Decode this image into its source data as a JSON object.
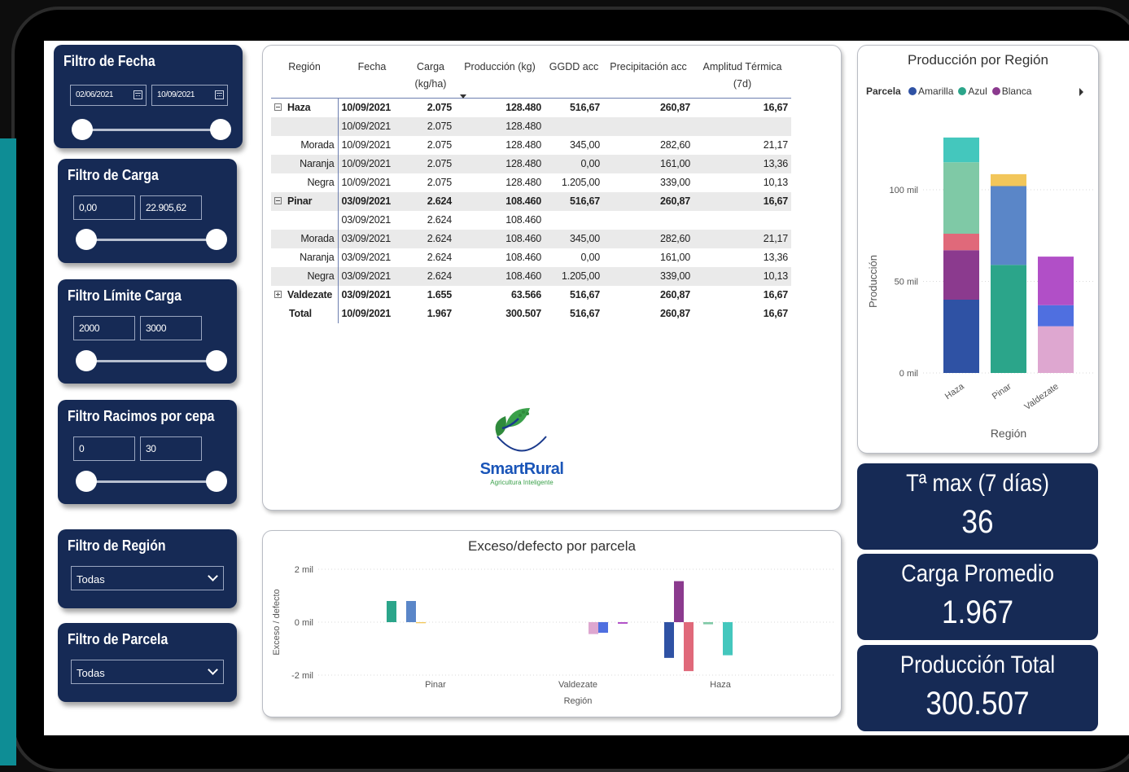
{
  "filters": {
    "fecha": {
      "title": "Filtro de Fecha",
      "start": "02/06/2021",
      "end": "10/09/2021"
    },
    "carga": {
      "title": "Filtro de Carga",
      "min": "0,00",
      "max": "22.905,62"
    },
    "limite": {
      "title": "Filtro Límite Carga",
      "min": "2000",
      "max": "3000"
    },
    "racimos": {
      "title": "Filtro Racimos por cepa",
      "min": "0",
      "max": "30"
    },
    "region": {
      "title": "Filtro de Región",
      "selected": "Todas"
    },
    "parcela": {
      "title": "Filtro de Parcela",
      "selected": "Todas"
    }
  },
  "matrix": {
    "headers": [
      "Región",
      "Fecha",
      "Carga (kg/ha)",
      "Producción (kg)",
      "GGDD acc",
      "Precipitación acc",
      "Amplitud Térmica (7d)"
    ],
    "rows": [
      {
        "type": "group",
        "expander": "minus",
        "region": "Haza",
        "fecha": "10/09/2021",
        "carga": "2.075",
        "prod": "128.480",
        "ggdd": "516,67",
        "precip": "260,87",
        "amp": "16,67"
      },
      {
        "type": "detail",
        "shade": true,
        "region": "",
        "fecha": "10/09/2021",
        "carga": "2.075",
        "prod": "128.480",
        "ggdd": "",
        "precip": "",
        "amp": ""
      },
      {
        "type": "detail",
        "shade": false,
        "region": "Morada",
        "fecha": "10/09/2021",
        "carga": "2.075",
        "prod": "128.480",
        "ggdd": "345,00",
        "precip": "282,60",
        "amp": "21,17"
      },
      {
        "type": "detail",
        "shade": true,
        "region": "Naranja",
        "fecha": "10/09/2021",
        "carga": "2.075",
        "prod": "128.480",
        "ggdd": "0,00",
        "precip": "161,00",
        "amp": "13,36"
      },
      {
        "type": "detail",
        "shade": false,
        "region": "Negra",
        "fecha": "10/09/2021",
        "carga": "2.075",
        "prod": "128.480",
        "ggdd": "1.205,00",
        "precip": "339,00",
        "amp": "10,13"
      },
      {
        "type": "group",
        "expander": "minus",
        "shade": true,
        "region": "Pinar",
        "fecha": "03/09/2021",
        "carga": "2.624",
        "prod": "108.460",
        "ggdd": "516,67",
        "precip": "260,87",
        "amp": "16,67"
      },
      {
        "type": "detail",
        "shade": false,
        "region": "",
        "fecha": "03/09/2021",
        "carga": "2.624",
        "prod": "108.460",
        "ggdd": "",
        "precip": "",
        "amp": ""
      },
      {
        "type": "detail",
        "shade": true,
        "region": "Morada",
        "fecha": "03/09/2021",
        "carga": "2.624",
        "prod": "108.460",
        "ggdd": "345,00",
        "precip": "282,60",
        "amp": "21,17"
      },
      {
        "type": "detail",
        "shade": false,
        "region": "Naranja",
        "fecha": "03/09/2021",
        "carga": "2.624",
        "prod": "108.460",
        "ggdd": "0,00",
        "precip": "161,00",
        "amp": "13,36"
      },
      {
        "type": "detail",
        "shade": true,
        "region": "Negra",
        "fecha": "03/09/2021",
        "carga": "2.624",
        "prod": "108.460",
        "ggdd": "1.205,00",
        "precip": "339,00",
        "amp": "10,13"
      },
      {
        "type": "group",
        "expander": "plus",
        "shade": false,
        "region": "Valdezate",
        "fecha": "03/09/2021",
        "carga": "1.655",
        "prod": "63.566",
        "ggdd": "516,67",
        "precip": "260,87",
        "amp": "16,67"
      },
      {
        "type": "total",
        "shade": false,
        "region": "Total",
        "fecha": "10/09/2021",
        "carga": "1.967",
        "prod": "300.507",
        "ggdd": "516,67",
        "precip": "260,87",
        "amp": "16,67"
      }
    ]
  },
  "logo": {
    "name": "SmartRural",
    "tagline": "Agricultura Inteligente"
  },
  "kpis": [
    {
      "label": "Tª max (7 días)",
      "value": "36"
    },
    {
      "label": "Carga Promedio",
      "value": "1.967"
    },
    {
      "label": "Producción Total",
      "value": "300.507"
    }
  ],
  "colors": {
    "navy": "#162a55",
    "teal": "#0e8d95"
  },
  "chart_data": [
    {
      "type": "bar",
      "stacked": true,
      "title": "Producción por Región",
      "xlabel": "Región",
      "ylabel": "Producción",
      "legend_title": "Parcela",
      "legend": [
        {
          "name": "Amarilla",
          "color": "#2f52a4"
        },
        {
          "name": "Azul",
          "color": "#2ba58a"
        },
        {
          "name": "Blanca",
          "color": "#8b3a8e"
        }
      ],
      "categories": [
        "Haza",
        "Pinar",
        "Valdezate"
      ],
      "yticks": [
        "0 mil",
        "50 mil",
        "100 mil"
      ],
      "ylim": [
        0,
        130000
      ],
      "stacks": [
        [
          {
            "value": 40000,
            "color": "#2f52a4"
          },
          {
            "value": 27000,
            "color": "#8b3a8e"
          },
          {
            "value": 9000,
            "color": "#e0697a"
          },
          {
            "value": 39000,
            "color": "#7fc9a6"
          },
          {
            "value": 13500,
            "color": "#44c7bd"
          }
        ],
        [
          {
            "value": 59000,
            "color": "#2ba58a"
          },
          {
            "value": 43000,
            "color": "#5a86c8"
          },
          {
            "value": 6500,
            "color": "#f2c65a"
          }
        ],
        [
          {
            "value": 25500,
            "color": "#dea7d0"
          },
          {
            "value": 11500,
            "color": "#4f6fe0"
          },
          {
            "value": 26500,
            "color": "#b14fc7"
          }
        ]
      ]
    },
    {
      "type": "bar",
      "title": "Exceso/defecto por parcela",
      "xlabel": "Región",
      "ylabel": "Exceso / defecto",
      "categories": [
        "Pinar",
        "Valdezate",
        "Haza"
      ],
      "yticks": [
        "2 mil",
        "0 mil",
        "-2 mil"
      ],
      "ylim": [
        -2000,
        2000
      ],
      "groups": [
        [
          {
            "value": 800,
            "color": "#2ba58a"
          },
          {
            "value": 0,
            "color": "#ffffff"
          },
          {
            "value": 800,
            "color": "#5a86c8"
          },
          {
            "value": -40,
            "color": "#f2c65a"
          }
        ],
        [
          {
            "value": -450,
            "color": "#dea7d0"
          },
          {
            "value": -400,
            "color": "#4f6fe0"
          },
          {
            "value": 0,
            "color": "#ffffff"
          },
          {
            "value": -60,
            "color": "#b14fc7"
          }
        ],
        [
          {
            "value": -1350,
            "color": "#2f52a4"
          },
          {
            "value": 1550,
            "color": "#8b3a8e"
          },
          {
            "value": -1850,
            "color": "#e0697a"
          },
          {
            "value": 0,
            "color": "#ffffff"
          },
          {
            "value": -80,
            "color": "#7fc9a6"
          },
          {
            "value": 0,
            "color": "#ffffff"
          },
          {
            "value": -1250,
            "color": "#44c7bd"
          }
        ]
      ]
    }
  ]
}
